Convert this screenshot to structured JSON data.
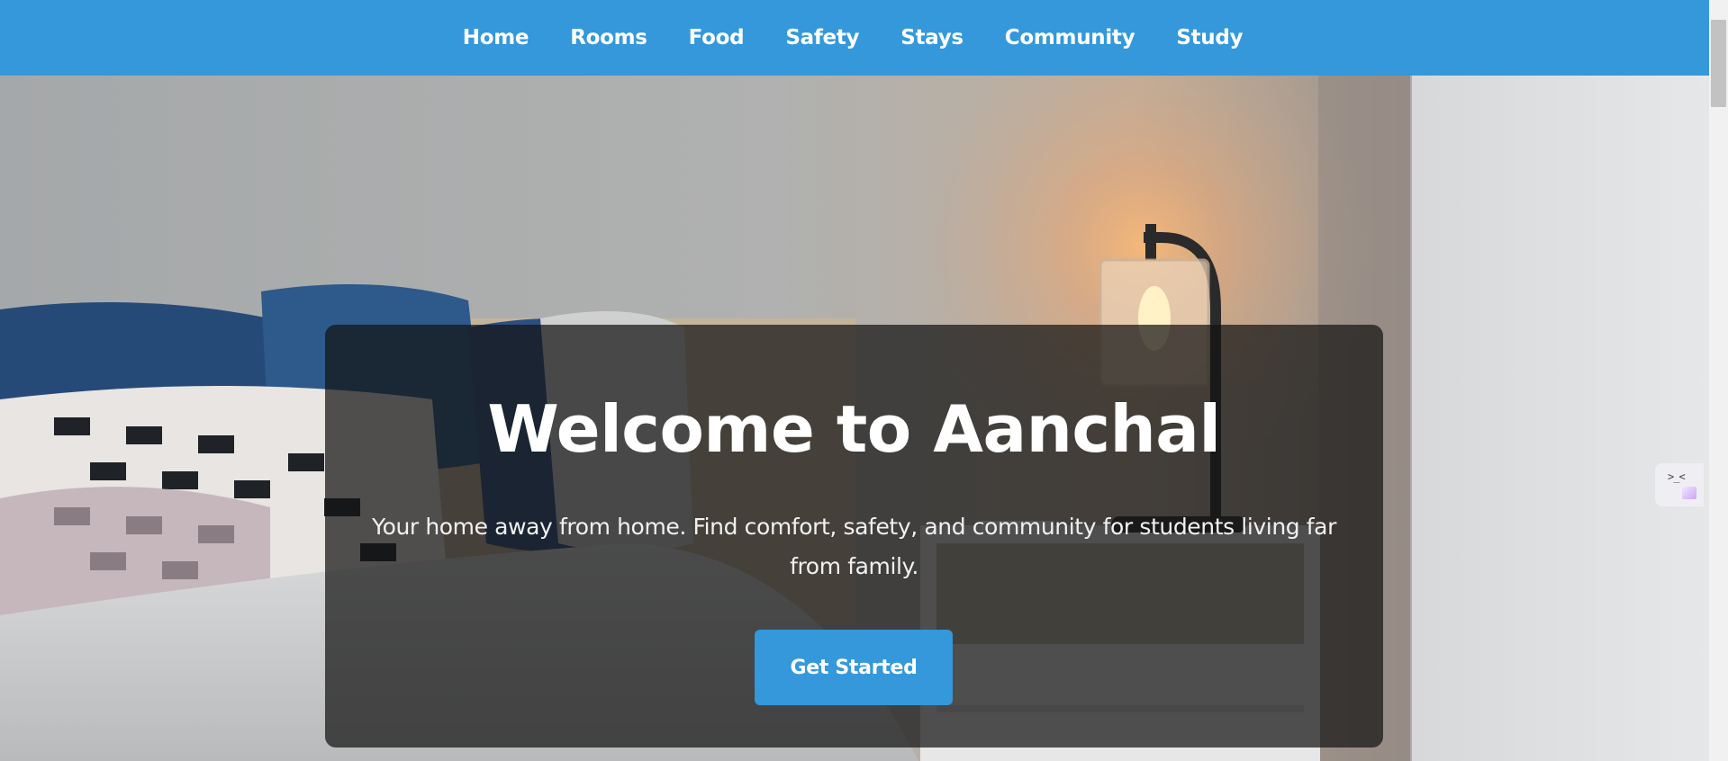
{
  "nav": {
    "items": [
      {
        "label": "Home"
      },
      {
        "label": "Rooms"
      },
      {
        "label": "Food"
      },
      {
        "label": "Safety"
      },
      {
        "label": "Stays"
      },
      {
        "label": "Community"
      },
      {
        "label": "Study"
      }
    ]
  },
  "hero": {
    "title": "Welcome to Aanchal",
    "subtitle": "Your home away from home. Find comfort, safety, and community for students living far from family.",
    "cta_label": "Get Started"
  },
  "colors": {
    "primary": "#3498db",
    "overlay": "rgba(20,20,20,0.72)",
    "text_light": "#ffffff"
  },
  "icons": {
    "side_widget": "assistant-face-icon",
    "side_widget_glyph": ">_<"
  }
}
